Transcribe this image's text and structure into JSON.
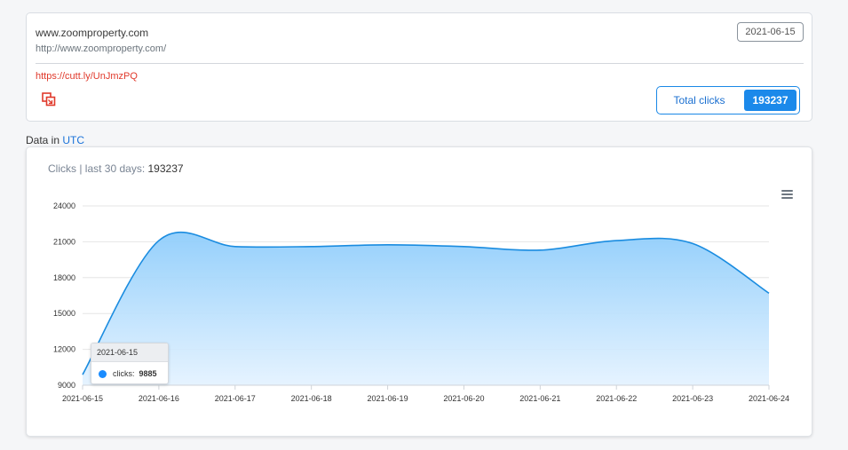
{
  "link": {
    "name": "www.zoomproperty.com",
    "url": "http://www.zoomproperty.com/",
    "date": "2021-06-15",
    "short_url": "https://cutt.ly/UnJmzPQ",
    "total_clicks_label": "Total clicks",
    "total_clicks_value": "193237"
  },
  "timezone": {
    "prefix": "Data in",
    "value": "UTC"
  },
  "chart_title": {
    "label": "Clicks | last 30 days:",
    "value": "193237"
  },
  "tooltip": {
    "date": "2021-06-15",
    "series": "clicks:",
    "value": "9885"
  },
  "icons": {
    "copy": "copy-icon",
    "menu": "hamburger-menu-icon"
  },
  "colors": {
    "accent": "#1b89ea",
    "short_url": "#e0392b",
    "series_line": "#1a8ce0",
    "series_fill": "#8fcdfb"
  },
  "chart_data": {
    "type": "area",
    "title": "Clicks | last 30 days: 193237",
    "x": [
      "2021-06-15",
      "2021-06-16",
      "2021-06-17",
      "2021-06-18",
      "2021-06-19",
      "2021-06-20",
      "2021-06-21",
      "2021-06-22",
      "2021-06-23",
      "2021-06-24"
    ],
    "series": [
      {
        "name": "clicks",
        "values": [
          9885,
          21100,
          20600,
          20600,
          20750,
          20600,
          20300,
          21100,
          20850,
          16700
        ]
      }
    ],
    "yticks": [
      9000,
      12000,
      15000,
      18000,
      21000,
      24000
    ],
    "ylim": [
      9000,
      24000
    ],
    "grid": true,
    "legend": "none"
  }
}
